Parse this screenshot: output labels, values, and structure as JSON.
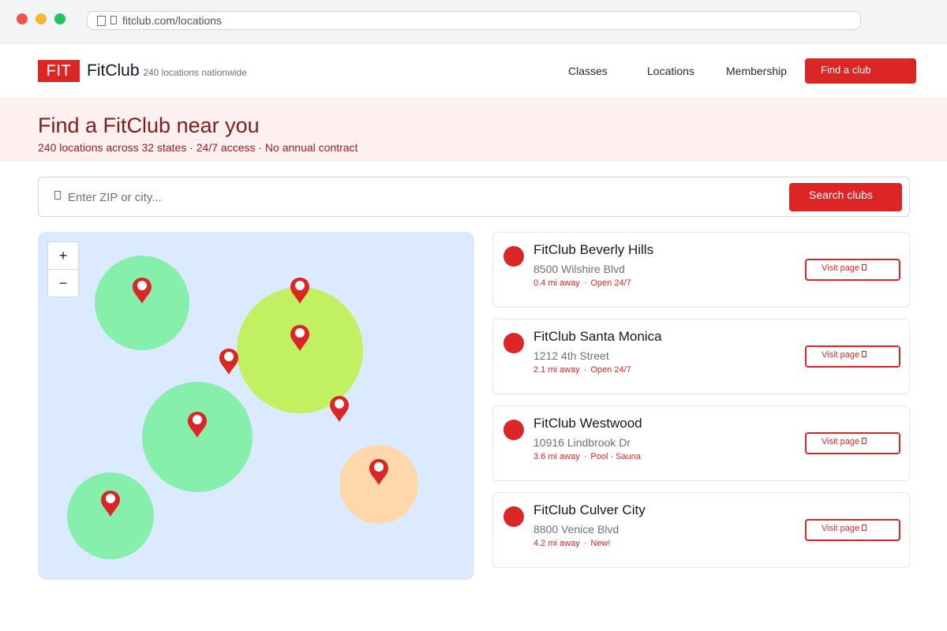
{
  "browser": {
    "url": "fitclub.com/locations"
  },
  "header": {
    "logo_text": "FIT",
    "brand": "FitClub",
    "brand_sub": "· 240 locations nationwide",
    "nav": [
      "Classes",
      "Locations",
      "Membership"
    ],
    "cta": "Find a club"
  },
  "hero": {
    "title": "Find a FitClub near you",
    "subtitle": "240 locations across 32 states · 24/7 access · No annual contract"
  },
  "search": {
    "placeholder": "Enter ZIP or city...",
    "button": "Search clubs"
  },
  "map": {
    "zoom_in": "+",
    "zoom_out": "−",
    "colors": {
      "background": "#dbeafe",
      "circle_green": "#86efac",
      "circle_lime": "#c1f160",
      "circle_orange": "#fed7aa",
      "pin": "#dc2626"
    }
  },
  "clubs": [
    {
      "name": "FitClub Beverly Hills",
      "address": "8500 Wilshire Blvd",
      "distance": "0.4 mi away",
      "tag": "Open 24/7",
      "button": "Visit page"
    },
    {
      "name": "FitClub Santa Monica",
      "address": "1212 4th Street",
      "distance": "2.1 mi away",
      "tag": "Open 24/7",
      "button": "Visit page"
    },
    {
      "name": "FitClub Westwood",
      "address": "10916 Lindbrook Dr",
      "distance": "3.6 mi away",
      "tag": "Pool · Sauna",
      "button": "Visit page"
    },
    {
      "name": "FitClub Culver City",
      "address": "8800 Venice Blvd",
      "distance": "4.2 mi away",
      "tag": "New!",
      "button": "Visit page"
    }
  ],
  "theme": {
    "accent": "#dc2626",
    "hero_bg": "#fff0f0"
  }
}
